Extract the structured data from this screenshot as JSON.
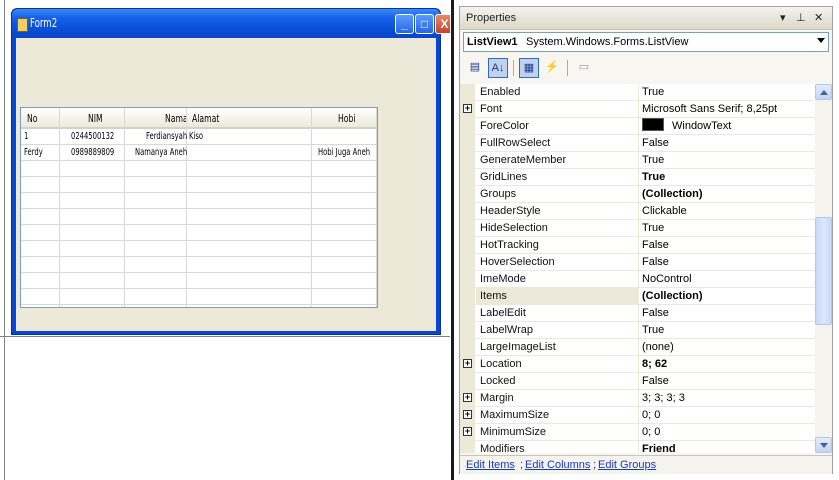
{
  "form": {
    "title": "Form2",
    "min_glyph": "_",
    "max_glyph": "□",
    "close_glyph": "X",
    "listview": {
      "columns": [
        "No",
        "NIM",
        "Nama",
        "Alamat",
        "Hobi"
      ],
      "rows": [
        [
          "1",
          "0244500132",
          "Ferdiansyah",
          "Kiso",
          ""
        ],
        [
          "Ferdy",
          "0989889809",
          "Namanya Aneh",
          "",
          "Hobi Juga Aneh"
        ]
      ]
    }
  },
  "properties": {
    "title": "Properties",
    "title_icons": [
      "dropdown-icon",
      "pin-icon",
      "close-icon"
    ],
    "object_name": "ListView1",
    "object_type": "System.Windows.Forms.ListView",
    "toolbar": [
      {
        "name": "categorized-icon",
        "glyph": "▤"
      },
      {
        "name": "alphabetical-icon",
        "glyph": "A↓"
      },
      {
        "name": "properties-icon",
        "glyph": "▦"
      },
      {
        "name": "events-icon",
        "glyph": "⚡"
      },
      {
        "name": "property-pages-icon",
        "glyph": "▭"
      }
    ],
    "rows": [
      {
        "name": "Enabled",
        "value": "True"
      },
      {
        "name": "Font",
        "value": "Microsoft Sans Serif; 8,25pt",
        "expandable": true
      },
      {
        "name": "ForeColor",
        "value": "WindowText",
        "swatch": "#000000"
      },
      {
        "name": "FullRowSelect",
        "value": "False"
      },
      {
        "name": "GenerateMember",
        "value": "True"
      },
      {
        "name": "GridLines",
        "value": "True",
        "bold": true
      },
      {
        "name": "Groups",
        "value": "(Collection)",
        "bold": true
      },
      {
        "name": "HeaderStyle",
        "value": "Clickable"
      },
      {
        "name": "HideSelection",
        "value": "True"
      },
      {
        "name": "HotTracking",
        "value": "False"
      },
      {
        "name": "HoverSelection",
        "value": "False"
      },
      {
        "name": "ImeMode",
        "value": "NoControl"
      },
      {
        "name": "Items",
        "value": "(Collection)",
        "bold": true,
        "selected": true
      },
      {
        "name": "LabelEdit",
        "value": "False"
      },
      {
        "name": "LabelWrap",
        "value": "True"
      },
      {
        "name": "LargeImageList",
        "value": "(none)"
      },
      {
        "name": "Location",
        "value": "8; 62",
        "bold": true,
        "expandable": true
      },
      {
        "name": "Locked",
        "value": "False"
      },
      {
        "name": "Margin",
        "value": "3; 3; 3; 3",
        "expandable": true
      },
      {
        "name": "MaximumSize",
        "value": "0; 0",
        "expandable": true
      },
      {
        "name": "MinimumSize",
        "value": "0; 0",
        "expandable": true
      },
      {
        "name": "Modifiers",
        "value": "Friend",
        "bold": true
      }
    ],
    "links": [
      "Edit Items",
      "Edit Columns",
      "Edit Groups"
    ],
    "link_separator": ";"
  }
}
